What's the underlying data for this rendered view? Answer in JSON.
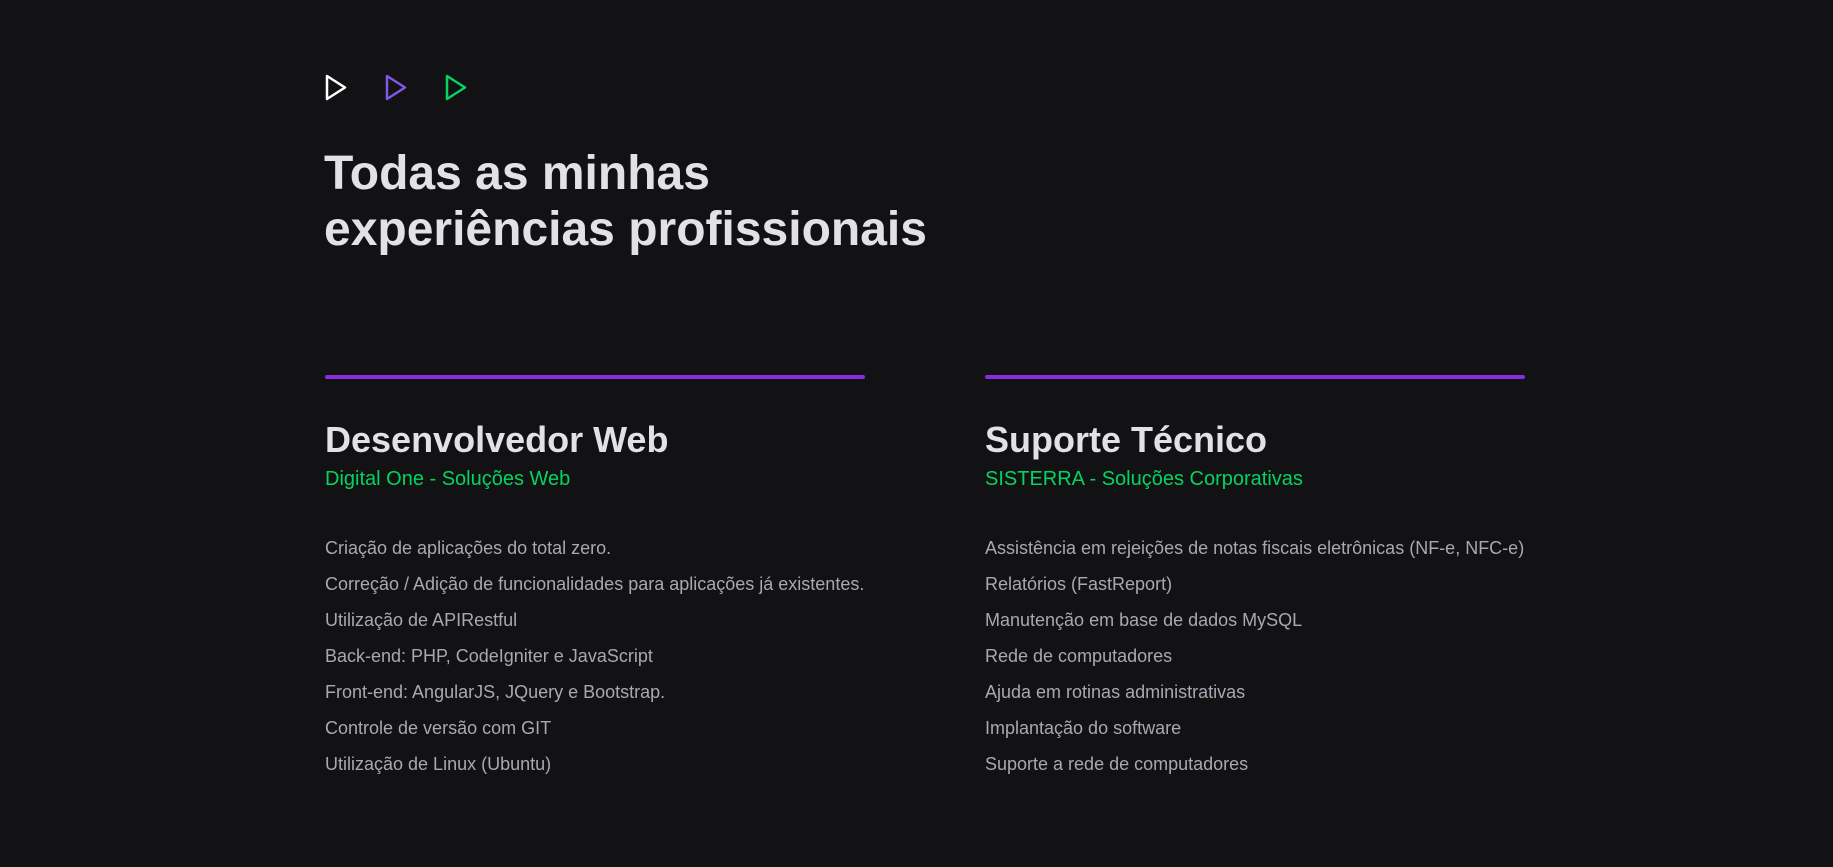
{
  "icons": [
    {
      "name": "play-outline-icon",
      "color": "#ffffff"
    },
    {
      "name": "play-outline-icon",
      "color": "#8257e5"
    },
    {
      "name": "play-outline-icon",
      "color": "#04d361"
    }
  ],
  "header": {
    "title_line1": "Todas as minhas",
    "title_line2": "experiências profissionais"
  },
  "colors": {
    "background": "#121214",
    "accent_bar": "#8a2be2",
    "company": "#04d361",
    "heading": "#e1e1e6",
    "text": "#a8a8b3"
  },
  "experiences": [
    {
      "role": "Desenvolvedor Web",
      "company": "Digital One - Soluções Web",
      "items": [
        "Criação de aplicações do total zero.",
        "Correção / Adição de funcionalidades para aplicações já existentes.",
        "Utilização de APIRestful",
        "Back-end: PHP, CodeIgniter e JavaScript",
        "Front-end: AngularJS, JQuery e Bootstrap.",
        "Controle de versão com GIT",
        "Utilização de Linux (Ubuntu)"
      ]
    },
    {
      "role": "Suporte Técnico",
      "company": "SISTERRA - Soluções Corporativas",
      "items": [
        "Assistência em rejeições de notas fiscais eletrônicas (NF-e, NFC-e)",
        "Relatórios (FastReport)",
        "Manutenção em base de dados MySQL",
        "Rede de computadores",
        "Ajuda em rotinas administrativas",
        "Implantação do software",
        "Suporte a rede de computadores"
      ]
    }
  ]
}
